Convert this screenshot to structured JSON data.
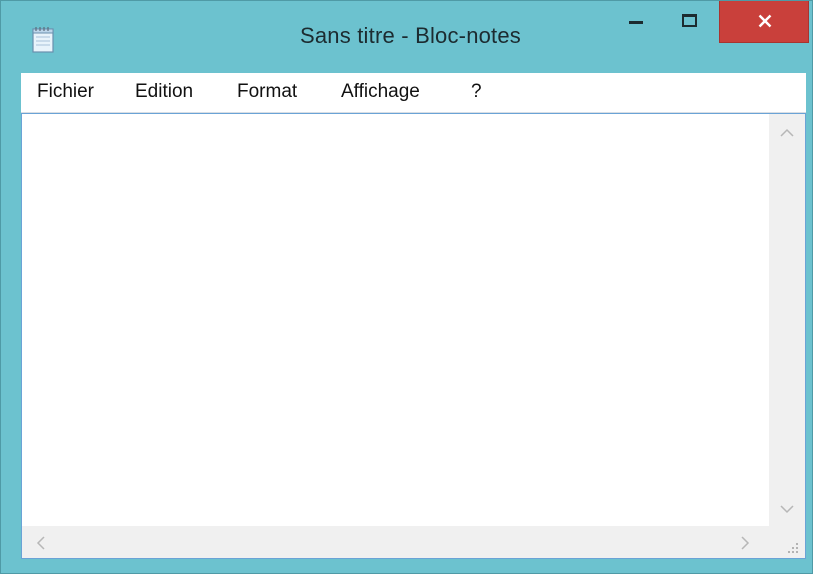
{
  "window": {
    "title": "Sans titre - Bloc-notes",
    "frame_color": "#6cc2cf",
    "close_color": "#c9403b"
  },
  "icons": {
    "app": "notepad-icon",
    "minimize": "minimize-icon",
    "maximize": "maximize-icon",
    "close": "close-icon",
    "scroll_up": "chevron-up-icon",
    "scroll_down": "chevron-down-icon",
    "scroll_left": "chevron-left-icon",
    "scroll_right": "chevron-right-icon",
    "size_grip": "size-grip-icon"
  },
  "menu": {
    "items": [
      {
        "label": "Fichier"
      },
      {
        "label": "Edition"
      },
      {
        "label": "Format"
      },
      {
        "label": "Affichage"
      },
      {
        "label": "?"
      }
    ]
  },
  "editor": {
    "content": ""
  }
}
